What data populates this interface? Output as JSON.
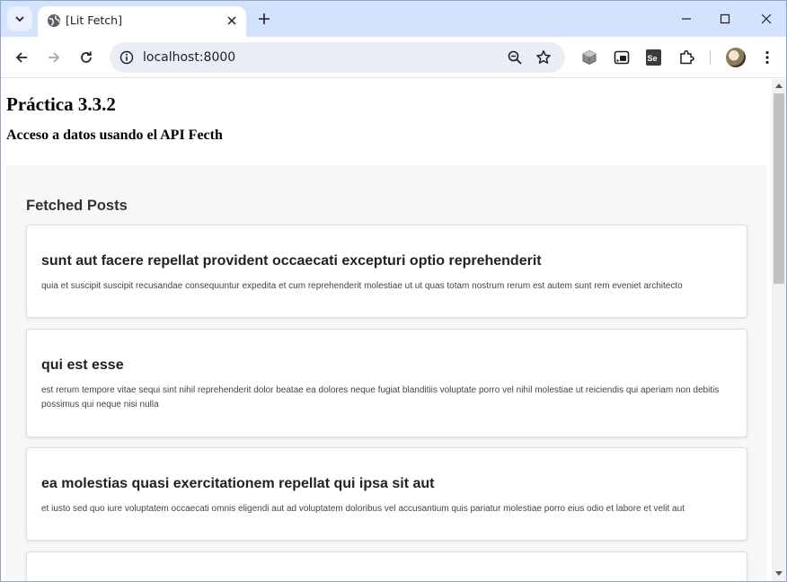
{
  "browser": {
    "tab_title": "[Lit Fetch]",
    "url": "localhost:8000",
    "icons": {
      "tab_search": "chevron-down-icon",
      "favicon": "globe-icon",
      "tab_close": "close-icon",
      "new_tab": "plus-icon",
      "minimize": "minimize-icon",
      "maximize": "maximize-icon",
      "close_window": "close-icon",
      "back": "arrow-left-icon",
      "forward": "arrow-right-icon",
      "reload": "reload-icon",
      "site_info": "site-info-icon",
      "zoom": "zoom-out-icon",
      "bookmark": "star-icon",
      "extensions": [
        "cube-icon",
        "cast-icon",
        "selenium-icon",
        "puzzle-icon"
      ],
      "menu": "kebab-menu-icon"
    },
    "extension_labels": {
      "selenium": "Se"
    }
  },
  "page": {
    "title": "Práctica 3.3.2",
    "subtitle": "Acceso a datos usando el API Fecth",
    "posts_heading": "Fetched Posts",
    "posts": [
      {
        "title": "sunt aut facere repellat provident occaecati excepturi optio reprehenderit",
        "body": "quia et suscipit suscipit recusandae consequuntur expedita et cum reprehenderit molestiae ut ut quas totam nostrum rerum est autem sunt rem eveniet architecto"
      },
      {
        "title": "qui est esse",
        "body": "est rerum tempore vitae sequi sint nihil reprehenderit dolor beatae ea dolores neque fugiat blanditiis voluptate porro vel nihil molestiae ut reiciendis qui aperiam non debitis possimus qui neque nisi nulla"
      },
      {
        "title": "ea molestias quasi exercitationem repellat qui ipsa sit aut",
        "body": "et iusto sed quo iure voluptatem occaecati omnis eligendi aut ad voluptatem doloribus vel accusantium quis pariatur molestiae porro eius odio et labore et velit aut"
      }
    ]
  }
}
